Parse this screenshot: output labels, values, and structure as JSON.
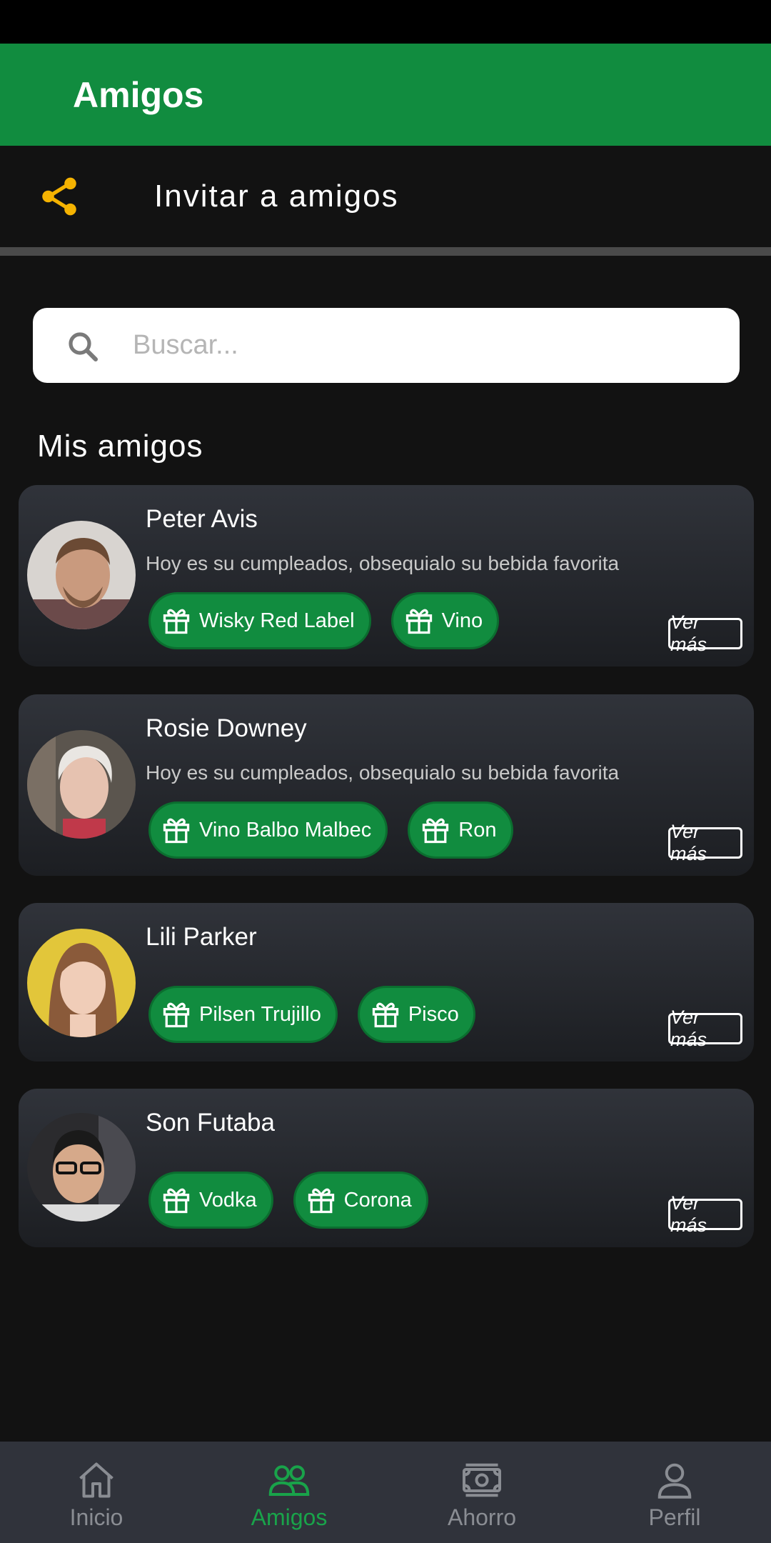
{
  "app_bar": {
    "title": "Amigos"
  },
  "invite": {
    "label": "Invitar a amigos"
  },
  "search": {
    "placeholder": "Buscar..."
  },
  "friends_section": {
    "title": "Mis amigos"
  },
  "friends": [
    {
      "name": "Peter Avis",
      "message": "Hoy es su cumpleados, obsequialo su bebida favorita",
      "gifts": [
        "Wisky Red Label",
        "Vino"
      ],
      "more_label": "Ver más"
    },
    {
      "name": "Rosie Downey",
      "message": "Hoy es su cumpleados, obsequialo su bebida favorita",
      "gifts": [
        "Vino Balbo Malbec",
        "Ron"
      ],
      "more_label": "Ver más"
    },
    {
      "name": "Lili Parker",
      "message": "",
      "gifts": [
        "Pilsen Trujillo",
        "Pisco"
      ],
      "more_label": "Ver más"
    },
    {
      "name": "Son Futaba",
      "message": "",
      "gifts": [
        "Vodka",
        "Corona"
      ],
      "more_label": "Ver más"
    }
  ],
  "bottom_nav": {
    "items": [
      {
        "label": "Inicio",
        "icon": "home-icon",
        "active": false
      },
      {
        "label": "Amigos",
        "icon": "friends-icon",
        "active": true
      },
      {
        "label": "Ahorro",
        "icon": "money-icon",
        "active": false
      },
      {
        "label": "Perfil",
        "icon": "profile-icon",
        "active": false
      }
    ]
  },
  "colors": {
    "accent_green": "#118c3f",
    "share_icon": "#f5b301",
    "background": "#121212",
    "nav_active": "#19a34a"
  }
}
